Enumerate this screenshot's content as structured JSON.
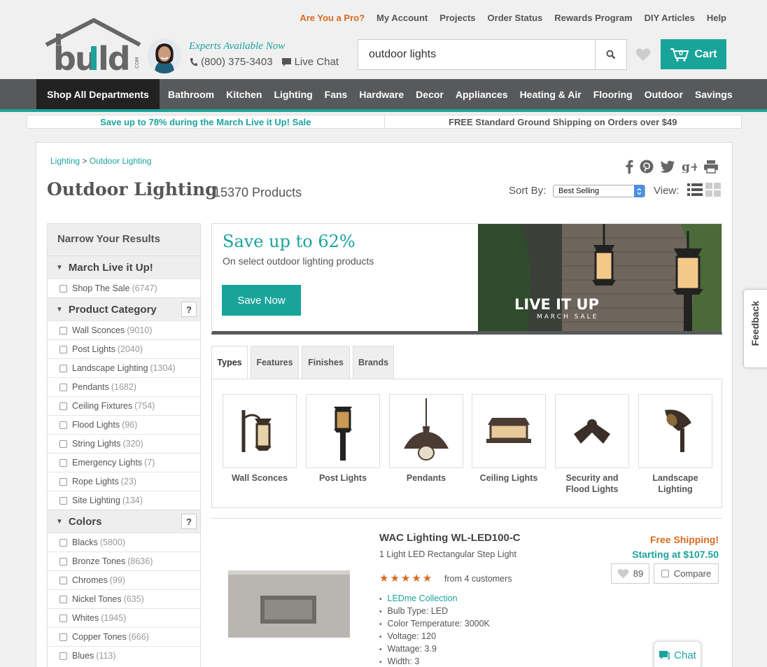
{
  "topnav": {
    "pro": "Are You a Pro?",
    "account": "My Account",
    "projects": "Projects",
    "order_status": "Order Status",
    "rewards": "Rewards Program",
    "diy": "DIY Articles",
    "help": "Help"
  },
  "header": {
    "logo": "build.com",
    "experts": "Experts Available Now",
    "phone": "(800) 375-3403",
    "live_chat": "Live Chat",
    "search_value": "outdoor lights",
    "cart_count": "0",
    "cart_label": "Cart"
  },
  "colors": {
    "accent": "#1ba39c",
    "orange": "#d96a1e",
    "navbar": "#58595b"
  },
  "catnav": {
    "shop_all": "Shop All Departments",
    "items": [
      "Bathroom",
      "Kitchen",
      "Lighting",
      "Fans",
      "Hardware",
      "Decor",
      "Appliances",
      "Heating & Air",
      "Flooring",
      "Outdoor",
      "Savings"
    ]
  },
  "promos": {
    "left": "Save up to 78% during the March Live it Up! Sale",
    "right": "FREE Standard Ground Shipping on Orders over $49"
  },
  "breadcrumb": {
    "first": "Lighting",
    "sep": ">",
    "second": "Outdoor Lighting"
  },
  "page": {
    "title": "Outdoor Lighting",
    "count": "15370 Products",
    "sort_label": "Sort By:",
    "sort_value": "Best Selling",
    "view_label": "View:"
  },
  "sidebar": {
    "header": "Narrow Your Results",
    "sections": [
      {
        "title": "March Live it Up!",
        "items": [
          {
            "label": "Shop The Sale",
            "count": "(6747)"
          }
        ]
      },
      {
        "title": "Product Category",
        "help": "?",
        "items": [
          {
            "label": "Wall Sconces",
            "count": "(9010)"
          },
          {
            "label": "Post Lights",
            "count": "(2040)"
          },
          {
            "label": "Landscape Lighting",
            "count": "(1304)"
          },
          {
            "label": "Pendants",
            "count": "(1682)"
          },
          {
            "label": "Ceiling Fixtures",
            "count": "(754)"
          },
          {
            "label": "Flood Lights",
            "count": "(96)"
          },
          {
            "label": "String Lights",
            "count": "(320)"
          },
          {
            "label": "Emergency Lights",
            "count": "(7)"
          },
          {
            "label": "Rope Lights",
            "count": "(23)"
          },
          {
            "label": "Site Lighting",
            "count": "(134)"
          }
        ]
      },
      {
        "title": "Colors",
        "help": "?",
        "items": [
          {
            "label": "Blacks",
            "count": "(5800)"
          },
          {
            "label": "Bronze Tones",
            "count": "(8636)"
          },
          {
            "label": "Chromes",
            "count": "(99)"
          },
          {
            "label": "Nickel Tones",
            "count": "(635)"
          },
          {
            "label": "Whites",
            "count": "(1945)"
          },
          {
            "label": "Copper Tones",
            "count": "(666)"
          },
          {
            "label": "Blues",
            "count": "(113)"
          }
        ]
      }
    ]
  },
  "banner": {
    "headline": "Save up to 62%",
    "sub": "On select outdoor lighting products",
    "button": "Save Now",
    "photo_text1": "LIVE IT UP",
    "photo_text2": "MARCH SALE"
  },
  "tabs": [
    "Types",
    "Features",
    "Finishes",
    "Brands"
  ],
  "types": [
    {
      "label": "Wall Sconces",
      "icon": "wall-sconce"
    },
    {
      "label": "Post Lights",
      "icon": "post-light"
    },
    {
      "label": "Pendants",
      "icon": "pendant"
    },
    {
      "label": "Ceiling Lights",
      "icon": "ceiling-light"
    },
    {
      "label": "Security and Flood Lights",
      "icon": "flood-light"
    },
    {
      "label": "Landscape Lighting",
      "icon": "landscape-light"
    }
  ],
  "product": {
    "name": "WAC Lighting WL-LED100-C",
    "desc": "1 Light LED Rectangular Step Light",
    "stars": "★★★★★",
    "reviews": "from 4 customers",
    "collection": "LEDme Collection",
    "specs": [
      "Bulb Type: LED",
      "Color Temperature: 3000K",
      "Voltage: 120",
      "Wattage: 3.9",
      "Width: 3"
    ],
    "free_shipping": "Free Shipping!",
    "price": "Starting at $107.50",
    "favorites": "89",
    "compare": "Compare"
  },
  "feedback": "Feedback",
  "chat": "Chat"
}
